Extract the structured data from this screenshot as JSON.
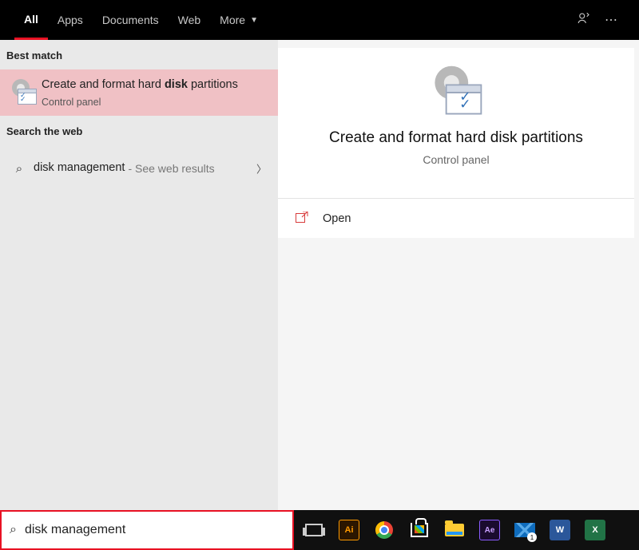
{
  "tabs": {
    "all": "All",
    "apps": "Apps",
    "documents": "Documents",
    "web": "Web",
    "more": "More"
  },
  "sections": {
    "best_match": "Best match",
    "search_web": "Search the web"
  },
  "best_result": {
    "title_pre": "Create and format hard ",
    "title_bold": "disk",
    "title_post": " partitions",
    "subtitle": "Control panel"
  },
  "web_result": {
    "query": "disk management",
    "hint": "- See web results"
  },
  "preview": {
    "title": "Create and format hard disk partitions",
    "subtitle": "Control panel"
  },
  "actions": {
    "open": "Open"
  },
  "search": {
    "value": "disk management"
  },
  "taskbar": {
    "ai": "Ai",
    "ae": "Ae",
    "word": "W",
    "excel": "X",
    "mail_badge": "1"
  }
}
